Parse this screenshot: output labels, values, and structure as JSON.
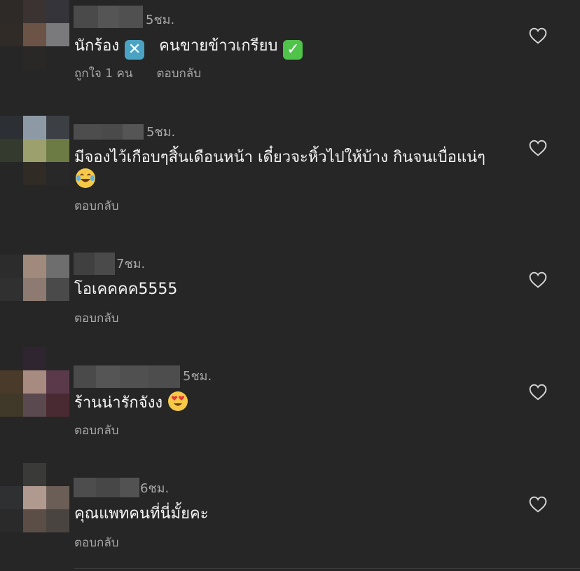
{
  "colors": {
    "background": "#262626",
    "text": "#f5f5f5",
    "muted": "#a8a8a8"
  },
  "comments": [
    {
      "time": "5ชม.",
      "text": "นักร้อง",
      "text2": "คนขายข้าวเกรียบ",
      "emoji1": "cross-mark-button",
      "emoji2": "check-mark-button",
      "likes": "ถูกใจ 1 คน",
      "reply": "ตอบกลับ"
    },
    {
      "time": "5ชม.",
      "text": "มีจองไว้เกือบๆสิ้นเดือนหน้า เดี๋ยวจะหิ้วไปให้บ้าง กินจนเบื่อแน่ๆ",
      "emoji": "face-with-tears-of-joy",
      "reply": "ตอบกลับ"
    },
    {
      "time": "7ชม.",
      "text": "โอเคคคค5555",
      "reply": "ตอบกลับ"
    },
    {
      "time": "5ชม.",
      "text": "ร้านน่ารักจังง",
      "emoji": "smiling-face-with-heart-eyes",
      "reply": "ตอบกลับ"
    },
    {
      "time": "6ชม.",
      "text": "คุณแพทคนที่นี่มั้ยคะ",
      "reply": "ตอบกลับ"
    }
  ]
}
